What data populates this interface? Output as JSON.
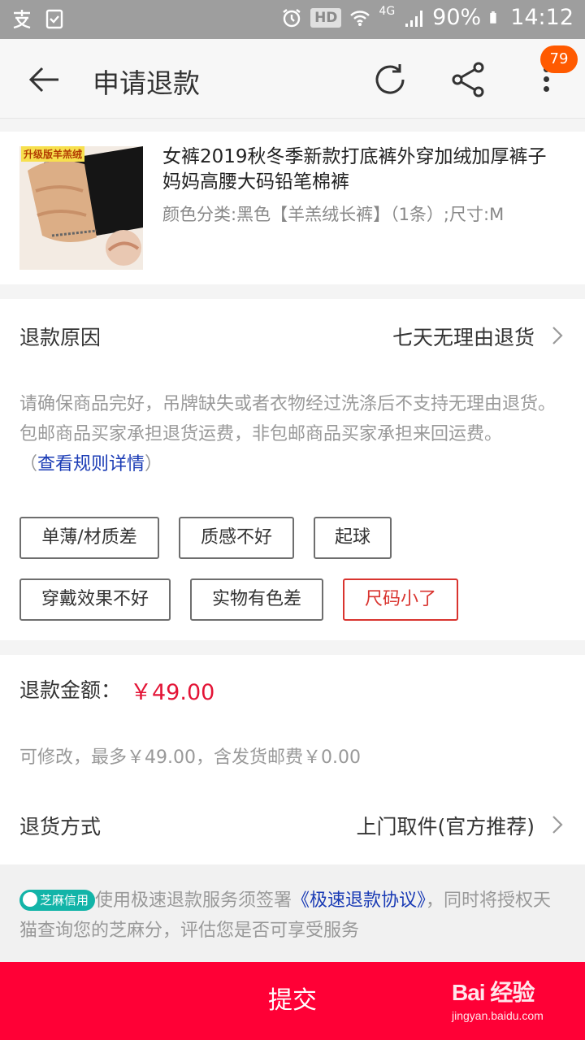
{
  "status_bar": {
    "hd": "HD",
    "network": "4G",
    "battery": "90%",
    "time": "14:12"
  },
  "header": {
    "title": "申请退款",
    "badge_count": "79"
  },
  "product": {
    "thumb_label": "升级版羊羔绒",
    "title": "女裤2019秋冬季新款打底裤外穿加绒加厚裤子妈妈高腰大码铅笔棉裤",
    "sku": "颜色分类:黑色【羊羔绒长裤】（1条）;尺寸:M"
  },
  "reason": {
    "label": "退款原因",
    "value": "七天无理由退货",
    "notice": "请确保商品完好，吊牌缺失或者衣物经过洗涤后不支持无理由退货。包邮商品买家承担退货运费，非包邮商品买家承担来回运费。",
    "rules_open": "（",
    "rules_link": "查看规则详情",
    "rules_close": "）",
    "tags": [
      "单薄/材质差",
      "质感不好",
      "起球",
      "穿戴效果不好",
      "实物有色差",
      "尺码小了"
    ],
    "selected_tag": "尺码小了"
  },
  "amount": {
    "label": "退款金额：",
    "value": "￥49.00",
    "hint": "可修改，最多￥49.00，含发货邮费￥0.00"
  },
  "return_method": {
    "label": "退货方式",
    "value": "上门取件(官方推荐)"
  },
  "zhima": {
    "badge": "芝麻信用",
    "text_before": "使用极速退款服务须签署",
    "link": "《极速退款协议》",
    "text_after": "，同时将授权天猫查询您的芝麻分，评估您是否可享受服务"
  },
  "submit": {
    "label": "提交"
  },
  "watermark": {
    "logo": "Bai 经验",
    "url": "jingyan.baidu.com"
  },
  "colors": {
    "accent": "#ff0036",
    "price": "#e31436",
    "selected_tag": "#d9342f",
    "badge": "#ff5a00",
    "link": "#1a3bb5",
    "zhima": "#12b4a8"
  }
}
